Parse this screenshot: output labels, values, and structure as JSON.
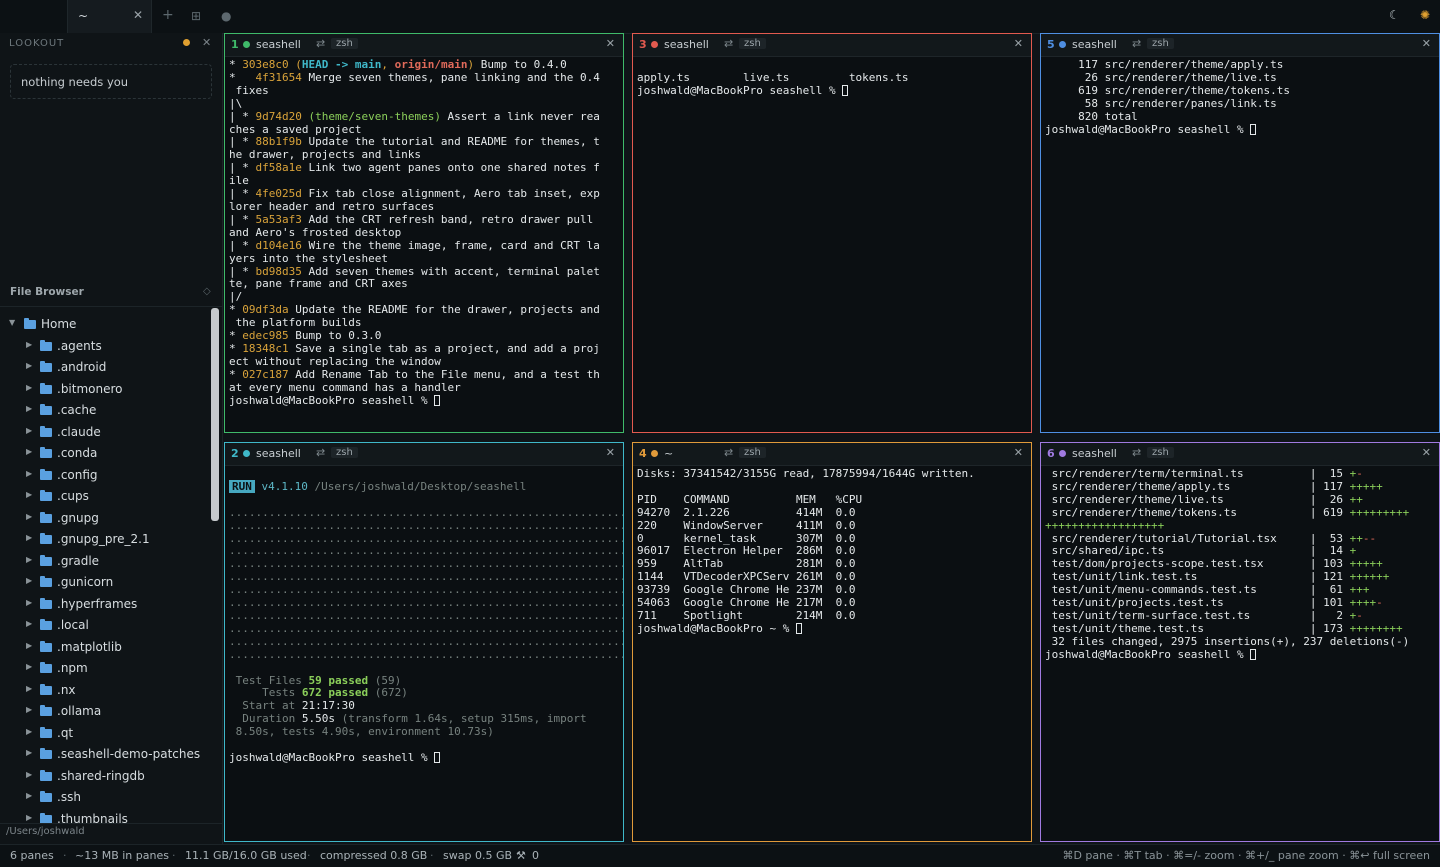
{
  "tabs": [
    {
      "label": "~"
    }
  ],
  "sidebar": {
    "lookout": {
      "title": "LOOKOUT",
      "message": "nothing needs you"
    },
    "file_browser": {
      "title": "File Browser",
      "root": "Home",
      "items": [
        ".agents",
        ".android",
        ".bitmonero",
        ".cache",
        ".claude",
        ".conda",
        ".config",
        ".cups",
        ".gnupg",
        ".gnupg_pre_2.1",
        ".gradle",
        ".gunicorn",
        ".hyperframes",
        ".local",
        ".matplotlib",
        ".npm",
        ".nx",
        ".ollama",
        ".qt",
        ".seashell-demo-patches",
        ".shared-ringdb",
        ".ssh",
        ".thumbnails"
      ],
      "cwd": "/Users/joshwald"
    }
  },
  "panes": [
    {
      "num": "1",
      "name": "seashell",
      "shell": "zsh",
      "color": "#3fba6a"
    },
    {
      "num": "3",
      "name": "seashell",
      "shell": "zsh",
      "color": "#e25a4f"
    },
    {
      "num": "5",
      "name": "seashell",
      "shell": "zsh",
      "color": "#4f8fe2"
    },
    {
      "num": "2",
      "name": "seashell",
      "shell": "zsh",
      "color": "#3fb8c9"
    },
    {
      "num": "4",
      "name": "~",
      "shell": "zsh",
      "color": "#e09a3a"
    },
    {
      "num": "6",
      "name": "seashell",
      "shell": "zsh",
      "color": "#a07ae0"
    }
  ],
  "prompt_seashell": "joshwald@MacBookPro seashell % ",
  "prompt_home": "joshwald@MacBookPro ~ % ",
  "pane1": {
    "lines": [
      {
        "prefix": "* ",
        "hash": "303e8c0",
        "text": " Bump to 0.4.0",
        "refs": true
      },
      {
        "prefix": "*   ",
        "hash": "4f31654",
        "text": " Merge seven themes, pane linking and the 0.4"
      },
      {
        "prefix": "",
        "hash": "",
        "text": " fixes"
      },
      {
        "prefix": "|\\",
        "hash": "",
        "text": ""
      },
      {
        "prefix": "| * ",
        "hash": "9d74d20",
        "text": " Assert a link never rea",
        "ref": "(theme/seven-themes)"
      },
      {
        "prefix": "",
        "hash": "",
        "text": "ches a saved project"
      },
      {
        "prefix": "| * ",
        "hash": "88b1f9b",
        "text": " Update the tutorial and README for themes, t"
      },
      {
        "prefix": "",
        "hash": "",
        "text": "he drawer, projects and links"
      },
      {
        "prefix": "| * ",
        "hash": "df58a1e",
        "text": " Link two agent panes onto one shared notes f"
      },
      {
        "prefix": "",
        "hash": "",
        "text": "ile"
      },
      {
        "prefix": "| * ",
        "hash": "4fe025d",
        "text": " Fix tab close alignment, Aero tab inset, exp"
      },
      {
        "prefix": "",
        "hash": "",
        "text": "lorer header and retro surfaces"
      },
      {
        "prefix": "| * ",
        "hash": "5a53af3",
        "text": " Add the CRT refresh band, retro drawer pull"
      },
      {
        "prefix": "",
        "hash": "",
        "text": "and Aero's frosted desktop"
      },
      {
        "prefix": "| * ",
        "hash": "d104e16",
        "text": " Wire the theme image, frame, card and CRT la"
      },
      {
        "prefix": "",
        "hash": "",
        "text": "yers into the stylesheet"
      },
      {
        "prefix": "| * ",
        "hash": "bd98d35",
        "text": " Add seven themes with accent, terminal palet"
      },
      {
        "prefix": "",
        "hash": "",
        "text": "te, pane frame and CRT axes"
      },
      {
        "prefix": "|/",
        "hash": "",
        "text": ""
      },
      {
        "prefix": "* ",
        "hash": "09df3da",
        "text": " Update the README for the drawer, projects and"
      },
      {
        "prefix": "",
        "hash": "",
        "text": " the platform builds"
      },
      {
        "prefix": "* ",
        "hash": "edec985",
        "text": " Bump to 0.3.0"
      },
      {
        "prefix": "* ",
        "hash": "1834 8c1",
        "text": " Save a single tab as a project, and add a proj"
      },
      {
        "prefix": "",
        "hash": "",
        "text": "ect without replacing the window"
      },
      {
        "prefix": "* ",
        "hash": "027c187",
        "text": " Add Rename Tab to the File menu, and a test th"
      },
      {
        "prefix": "",
        "hash": "",
        "text": "at every menu command has a handler"
      }
    ],
    "head_refs": {
      "open": "(",
      "head": "HEAD -> main",
      "sep": ", ",
      "origin": "origin/main",
      "close": ")"
    }
  },
  "pane3": {
    "files": [
      "apply.ts",
      "live.ts",
      "tokens.ts"
    ]
  },
  "pane5": {
    "lines": [
      "     117 src/renderer/theme/apply.ts",
      "      26 src/renderer/theme/live.ts",
      "     619 src/renderer/theme/tokens.ts",
      "      58 src/renderer/panes/link.ts",
      "     820 total"
    ]
  },
  "pane2": {
    "run_badge": "RUN",
    "version": "v4.1.10",
    "path": "/Users/joshwald/Desktop/seashell",
    "dots_line": "...............................................................",
    "dots_count": 12,
    "tests": [
      {
        "label": "Test Files",
        "value": "59 passed",
        "extra": "(59)"
      },
      {
        "label": "Tests",
        "value": "672 passed",
        "extra": "(672)"
      },
      {
        "label": "Start at",
        "value": "21:17:30",
        "extra": ""
      },
      {
        "label": "Duration",
        "value": "5.50s",
        "extra": "(transform 1.64s, setup 315ms, import"
      }
    ],
    "duration_wrap": " 8.50s, tests 4.90s, environment 10.73s)"
  },
  "pane4": {
    "disks": "Disks: 37341542/3155G read, 17875994/1644G written.",
    "header": "PID    COMMAND          MEM   %CPU",
    "rows": [
      "94270  2.1.226          414M  0.0",
      "220    WindowServer     411M  0.0",
      "0      kernel_task      307M  0.0",
      "96017  Electron Helper  286M  0.0",
      "959    AltTab           281M  0.0",
      "1144   VTDecoderXPCServ 261M  0.0",
      "93739  Google Chrome He 237M  0.0",
      "54063  Google Chrome He 217M  0.0",
      "711    Spotlight        214M  0.0"
    ]
  },
  "pane6": {
    "rows": [
      {
        "file": " src/renderer/term/terminal.ts          ",
        "n": "  15 ",
        "plus": "+",
        "minus": "-"
      },
      {
        "file": " src/renderer/theme/apply.ts            ",
        "n": " 117 ",
        "plus": "+++++",
        "minus": ""
      },
      {
        "file": " src/renderer/theme/live.ts             ",
        "n": "  26 ",
        "plus": "++",
        "minus": ""
      },
      {
        "file": " src/renderer/theme/tokens.ts           ",
        "n": " 619 ",
        "plus": "+++++++++",
        "minus": ""
      },
      {
        "wrap": "++++++++++++++++++"
      },
      {
        "file": " src/renderer/tutorial/Tutorial.tsx     ",
        "n": "  53 ",
        "plus": "++",
        "minus": "--"
      },
      {
        "file": " src/shared/ipc.ts                      ",
        "n": "  14 ",
        "plus": "+",
        "minus": ""
      },
      {
        "file": " test/dom/projects-scope.test.tsx       ",
        "n": " 103 ",
        "plus": "+++++",
        "minus": ""
      },
      {
        "file": " test/unit/link.test.ts                 ",
        "n": " 121 ",
        "plus": "++++++",
        "minus": ""
      },
      {
        "file": " test/unit/menu-commands.test.ts        ",
        "n": "  61 ",
        "plus": "+++",
        "minus": ""
      },
      {
        "file": " test/unit/projects.test.ts             ",
        "n": " 101 ",
        "plus": "++++",
        "minus": "-"
      },
      {
        "file": " test/unit/term-surface.test.ts         ",
        "n": "   2 ",
        "plus": "+",
        "minus": "-"
      },
      {
        "file": " test/unit/theme.test.ts                ",
        "n": " 173 ",
        "plus": "++++++++",
        "minus": ""
      }
    ],
    "summary": " 32 files changed, 2975 insertions(+), 237 deletions(-)"
  },
  "statusbar": {
    "panes": "6 panes",
    "mem_in_panes": "~13 MB in panes",
    "used": "11.1 GB/16.0 GB used",
    "compressed": "compressed 0.8 GB",
    "swap": "swap 0.5 GB",
    "agents": "0",
    "hints": "⌘D pane · ⌘T tab · ⌘=/- zoom · ⌘+/_ pane zoom · ⌘↩ full screen"
  },
  "colors": {
    "accent_green": "#3fba6a",
    "accent_red": "#e25a4f",
    "accent_blue": "#4f8fe2",
    "accent_cyan": "#3fb8c9",
    "accent_orange": "#e09a3a",
    "accent_purple": "#a07ae0"
  }
}
